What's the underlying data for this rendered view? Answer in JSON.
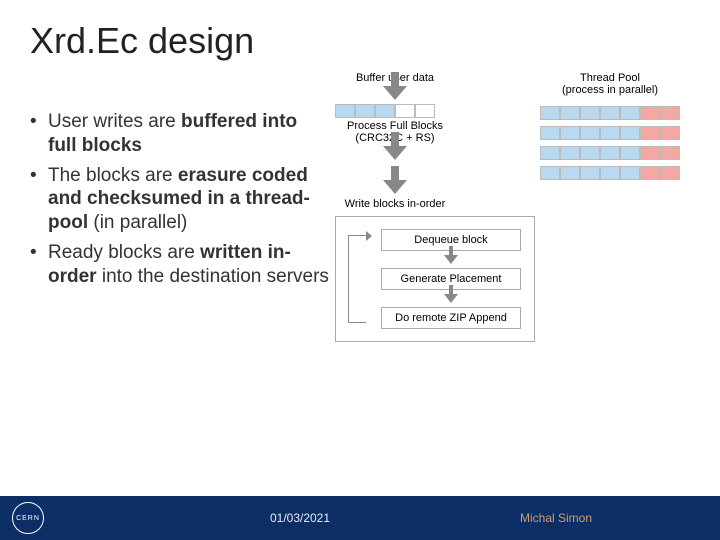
{
  "title": "Xrd.Ec design",
  "bullets": [
    {
      "pre": "User writes are ",
      "strong": "buffered into full blocks",
      "post": ""
    },
    {
      "pre": "The blocks are ",
      "strong": "erasure coded and checksumed in a thread-pool",
      "post": " (in parallel)"
    },
    {
      "pre": "Ready blocks are ",
      "strong": "written in-order",
      "post": " into the destination servers"
    }
  ],
  "diagram": {
    "buffer_label": "Buffer user data",
    "process_label_line1": "Process Full Blocks",
    "process_label_line2": "(CRC32C + RS)",
    "thread_pool_line1": "Thread Pool",
    "thread_pool_line2": "(process in parallel)",
    "write_label": "Write blocks in-order",
    "dequeue": "Dequeue block",
    "placement": "Generate Placement",
    "append": "Do remote ZIP Append"
  },
  "footer": {
    "logo_text": "CERN",
    "date": "01/03/2021",
    "author": "Michal Simon"
  }
}
